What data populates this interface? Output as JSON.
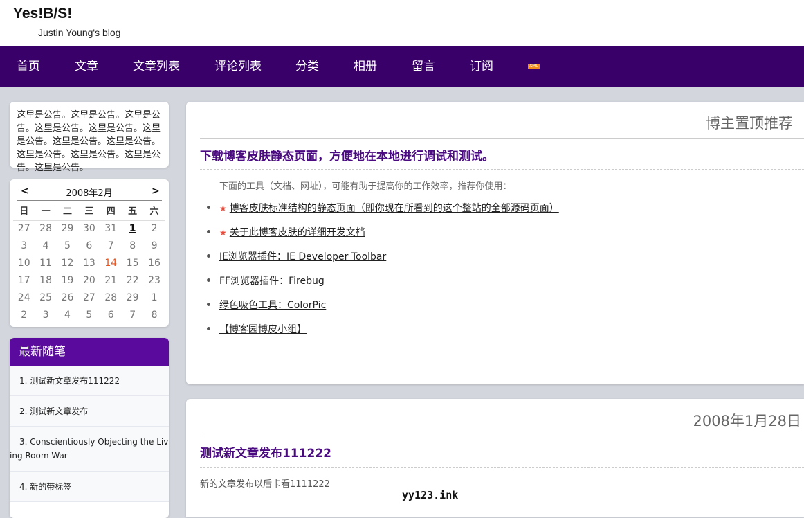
{
  "site": {
    "title": "Yes!B/S!",
    "subtitle": "Justin Young's blog"
  },
  "nav": {
    "items": [
      "首页",
      "文章",
      "文章列表",
      "评论列表",
      "分类",
      "相册",
      "留言",
      "订阅"
    ],
    "xml_badge": "XML",
    "bg_color": "#3a006a"
  },
  "notice": {
    "text": "这里是公告。这里是公告。这里是公告。这里是公告。这里是公告。这里是公告。这里是公告。这里是公告。这里是公告。这里是公告。这里是公告。这里是公告。"
  },
  "calendar": {
    "prev": "<",
    "next": ">",
    "title": "2008年2月",
    "weekdays": [
      "日",
      "一",
      "二",
      "三",
      "四",
      "五",
      "六"
    ],
    "weeks": [
      [
        "27",
        "28",
        "29",
        "30",
        "31",
        "1",
        "2"
      ],
      [
        "3",
        "4",
        "5",
        "6",
        "7",
        "8",
        "9"
      ],
      [
        "10",
        "11",
        "12",
        "13",
        "14",
        "15",
        "16"
      ],
      [
        "17",
        "18",
        "19",
        "20",
        "21",
        "22",
        "23"
      ],
      [
        "24",
        "25",
        "26",
        "27",
        "28",
        "29",
        "1"
      ],
      [
        "2",
        "3",
        "4",
        "5",
        "6",
        "7",
        "8"
      ]
    ],
    "today": "1",
    "highlight": "14"
  },
  "recent": {
    "title": "最新随笔",
    "items": [
      "1. 测试新文章发布111222",
      "2. 测试新文章发布",
      "3. Conscientiously Objecting the Living Room War",
      "4. 新的带标签"
    ]
  },
  "pinned": {
    "section_title": "博主置顶推荐",
    "post_title": "下载博客皮肤静态页面，方便地在本地进行调试和测试。",
    "intro": "下面的工具（文档、网址），可能有助于提高你的工作效率，推荐你使用：",
    "links": [
      {
        "text": "博客皮肤标准结构的静态页面（即你现在所看到的这个整站的全部源码页面）",
        "star": true
      },
      {
        "text": "关于此博客皮肤的详细开发文档",
        "star": true
      },
      {
        "text": "IE浏览器插件：IE Developer Toolbar",
        "star": false
      },
      {
        "text": "FF浏览器插件：Firebug",
        "star": false
      },
      {
        "text": "绿色吸色工具：ColorPic",
        "star": false
      },
      {
        "text": "【博客园博皮小组】",
        "star": false
      }
    ]
  },
  "post": {
    "date": "2008年1月28日",
    "title": "测试新文章发布111222",
    "summary": "新的文章发布以后卡看1111222"
  },
  "watermark": "yy123.ink"
}
